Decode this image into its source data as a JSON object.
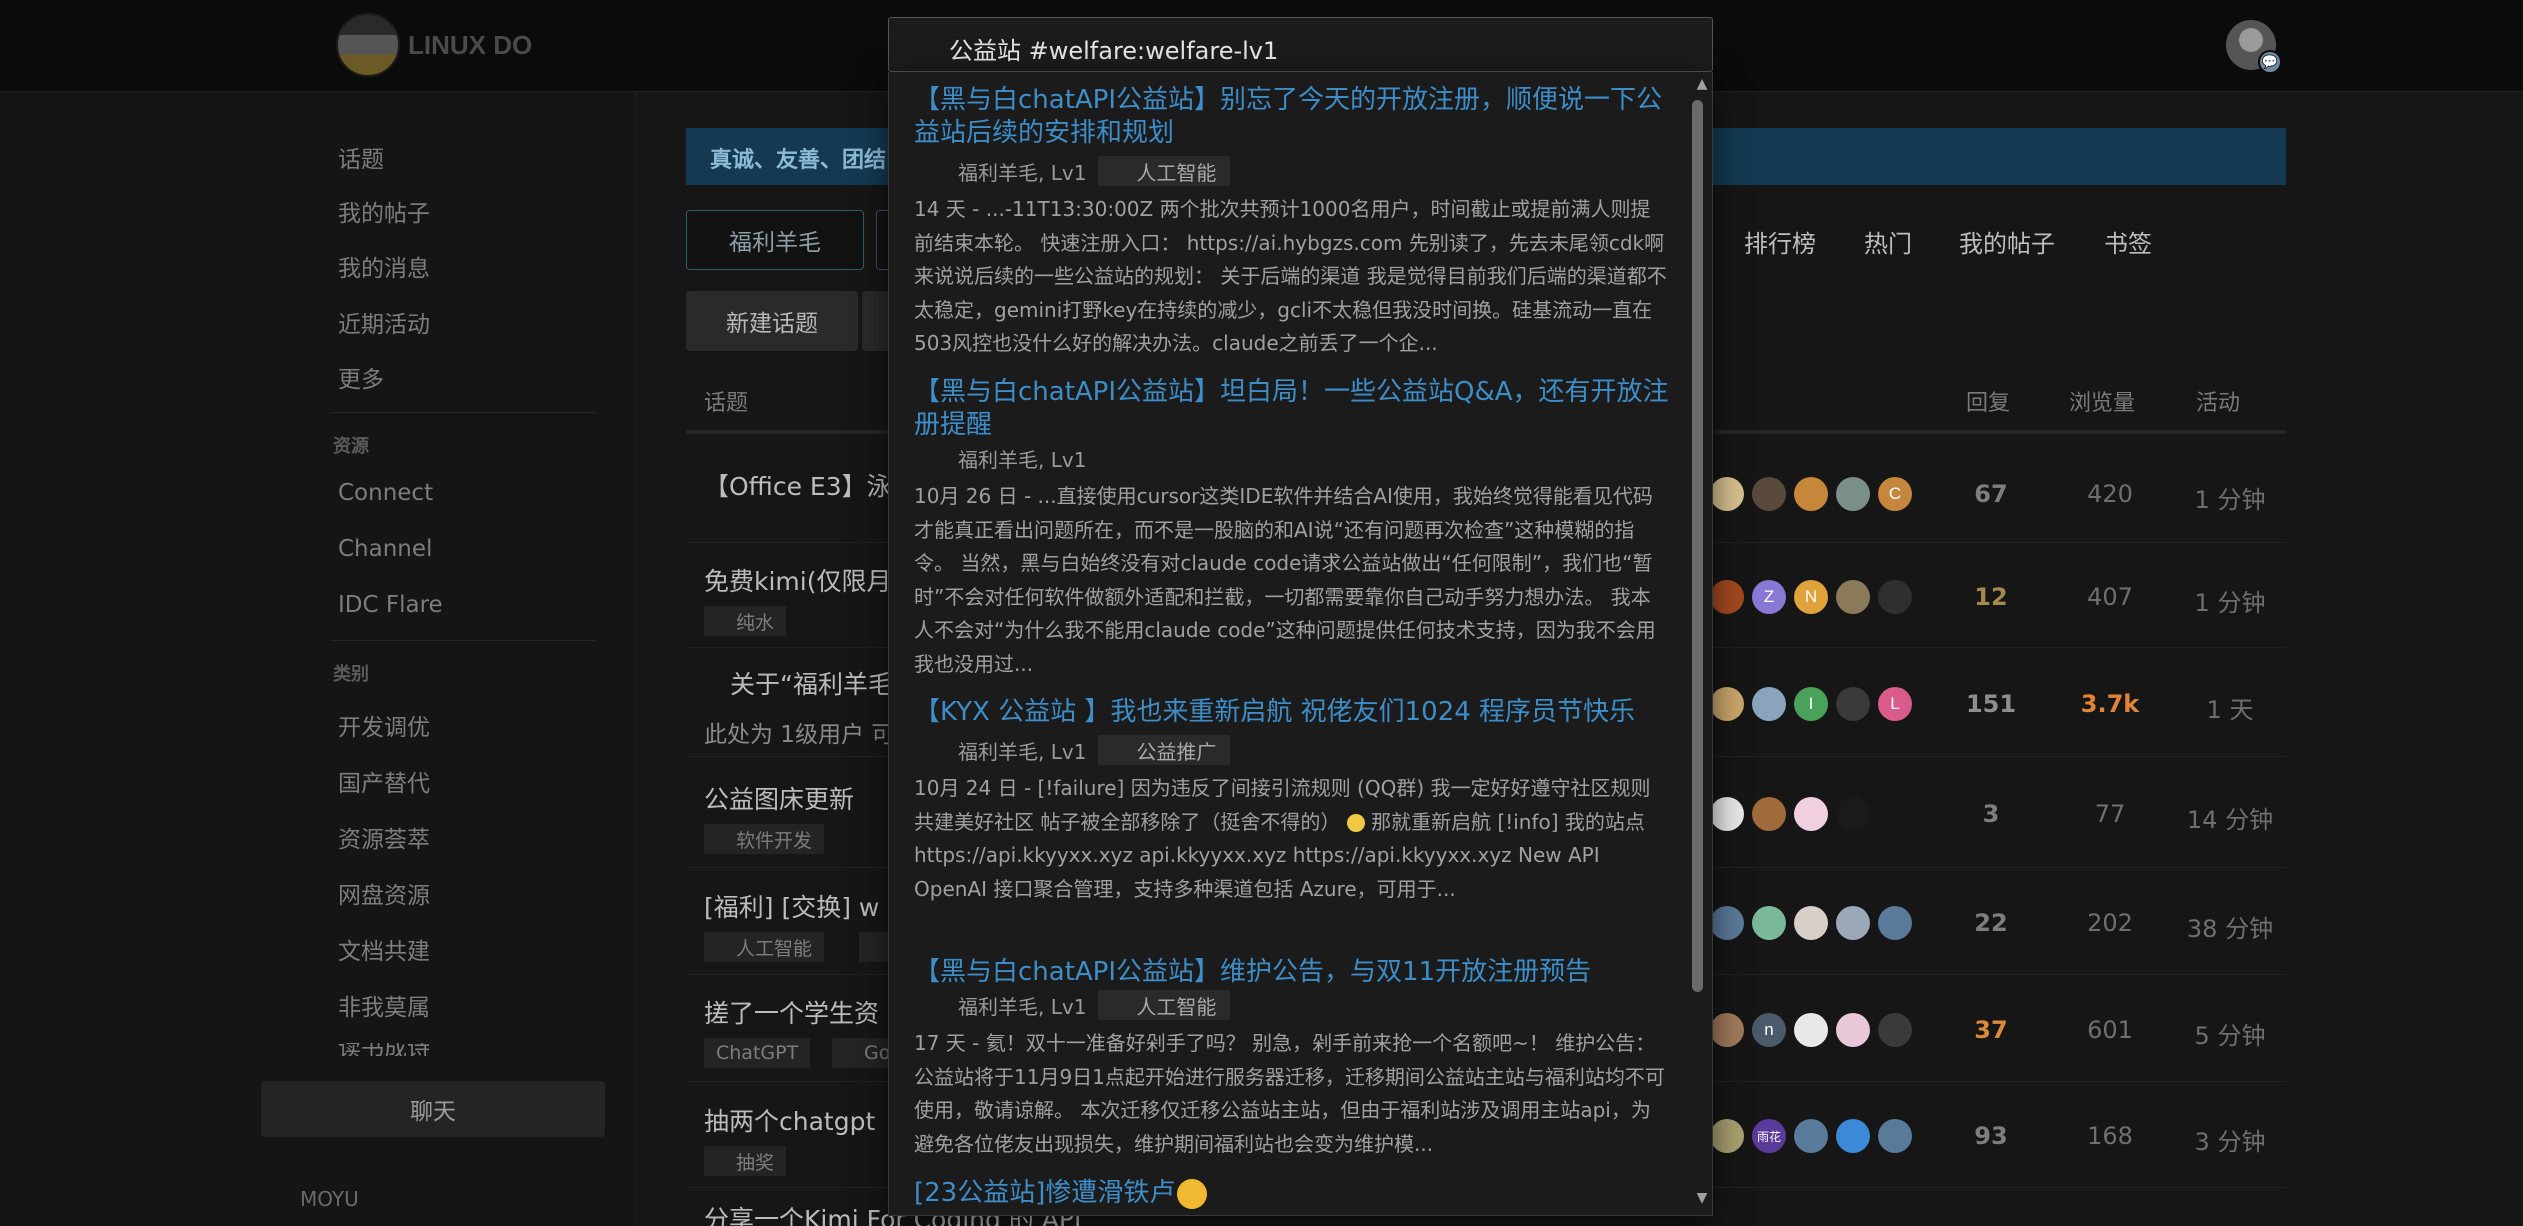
{
  "header": {
    "logo_text": "LINUX DO",
    "chat_badge": "💬"
  },
  "sidebar": {
    "items": [
      "话题",
      "我的帖子",
      "我的消息",
      "近期活动",
      "更多"
    ],
    "resources_label": "资源",
    "resources": [
      "Connect",
      "Channel",
      "IDC Flare"
    ],
    "categories_label": "类别",
    "categories": [
      "开发调优",
      "国产替代",
      "资源荟萃",
      "网盘资源",
      "文档共建",
      "非我莫属",
      "读书成诗"
    ],
    "chat_label": "聊天",
    "moyu_label": "MOYU"
  },
  "main": {
    "banner": "真诚、友善、团结",
    "filter_buttons": [
      "福利羊毛"
    ],
    "nav_links": [
      "排行榜",
      "热门",
      "我的帖子",
      "书签"
    ],
    "new_topic": "新建话题",
    "columns": {
      "topic": "话题",
      "replies": "回复",
      "views": "浏览量",
      "activity": "活动"
    },
    "topics": [
      {
        "title": "【Office E3】泳",
        "tags": [],
        "excerpt": "",
        "avatars": [
          {
            "c": "#d7c08f",
            "t": ""
          },
          {
            "c": "#5a4a3c",
            "t": ""
          },
          {
            "c": "#c7873a",
            "t": ""
          },
          {
            "c": "#7a8f8a",
            "t": ""
          },
          {
            "c": "#c4873d",
            "t": "C"
          }
        ],
        "replies": "67",
        "views": "420",
        "activity": "1 分钟",
        "replies_color": "#7e7e7e",
        "views_color": "#6f6f6f"
      },
      {
        "title": "免费kimi(仅限月",
        "tags": [
          "纯水"
        ],
        "excerpt": "",
        "avatars": [
          {
            "c": "#a34a1e",
            "t": ""
          },
          {
            "c": "#8a78d6",
            "t": "Z"
          },
          {
            "c": "#e0a23a",
            "t": "N"
          },
          {
            "c": "#8a7a5a",
            "t": ""
          },
          {
            "c": "#2f2f2f",
            "t": ""
          }
        ],
        "replies": "12",
        "views": "407",
        "activity": "1 分钟",
        "replies_color": "#a48a4c",
        "views_color": "#6f6f6f"
      },
      {
        "title": "关于“福利羊毛",
        "tags": [],
        "excerpt": "此处为 1级用户 可",
        "avatars": [
          {
            "c": "#c9a76a",
            "t": ""
          },
          {
            "c": "#8aa4bb",
            "t": ""
          },
          {
            "c": "#4aa15a",
            "t": "I"
          },
          {
            "c": "#3a3a3a",
            "t": ""
          },
          {
            "c": "#d95b8c",
            "t": "L"
          }
        ],
        "replies": "151",
        "views": "3.7k",
        "activity": "1 天",
        "replies_color": "#8e8e8e",
        "views_color": "#e1843a"
      },
      {
        "title": "公益图床更新",
        "tags": [
          "软件开发"
        ],
        "excerpt": "",
        "avatars": [
          {
            "c": "#e8e8e8",
            "t": ""
          },
          {
            "c": "#a06a3a",
            "t": ""
          },
          {
            "c": "#f0d0e0",
            "t": ""
          },
          {
            "c": "#1a1a1a",
            "t": ""
          }
        ],
        "replies": "3",
        "views": "77",
        "activity": "14 分钟",
        "replies_color": "#7e7e7e",
        "views_color": "#6f6f6f"
      },
      {
        "title": "[福利] [交换] w",
        "tags": [
          "人工智能",
          "Ch"
        ],
        "excerpt": "",
        "avatars": [
          {
            "c": "#5a7a9a",
            "t": ""
          },
          {
            "c": "#7ab89a",
            "t": ""
          },
          {
            "c": "#d8d0c8",
            "t": ""
          },
          {
            "c": "#9aa8b8",
            "t": ""
          },
          {
            "c": "#5a7a9a",
            "t": ""
          }
        ],
        "replies": "22",
        "views": "202",
        "activity": "38 分钟",
        "replies_color": "#7e7e7e",
        "views_color": "#6f6f6f"
      },
      {
        "title": "搓了一个学生资",
        "tags": [
          "ChatGPT",
          "Goog"
        ],
        "excerpt": "",
        "avatars": [
          {
            "c": "#a07a5a",
            "t": ""
          },
          {
            "c": "#4a5a6a",
            "t": "n"
          },
          {
            "c": "#e8e8e8",
            "t": ""
          },
          {
            "c": "#e8c8d8",
            "t": ""
          },
          {
            "c": "#3a3a3a",
            "t": ""
          }
        ],
        "replies": "37",
        "views": "601",
        "activity": "5 分钟",
        "replies_color": "#d98a3a",
        "views_color": "#6f6f6f"
      },
      {
        "title": "抽两个chatgpt",
        "tags": [
          "抽奖"
        ],
        "excerpt": "",
        "avatars": [
          {
            "c": "#a8a070",
            "t": ""
          },
          {
            "c": "#5a3a9a",
            "t": "雨花"
          },
          {
            "c": "#5a7a9a",
            "t": ""
          },
          {
            "c": "#3a8ad8",
            "t": ""
          },
          {
            "c": "#5a7a9a",
            "t": ""
          }
        ],
        "replies": "93",
        "views": "168",
        "activity": "3 分钟",
        "replies_color": "#7e7e7e",
        "views_color": "#6f6f6f"
      },
      {
        "title": "分享一个Kimi For Coding 的 API",
        "tags": [],
        "excerpt": "",
        "avatars": [],
        "replies": "",
        "views": "",
        "activity": "",
        "replies_color": "#7e7e7e",
        "views_color": "#6f6f6f"
      }
    ]
  },
  "search": {
    "query": "公益站 #welfare:welfare-lv1",
    "results": [
      {
        "title": "【黑与白chatAPI公益站】别忘了今天的开放注册，顺便说一下公益站后续的安排和规划",
        "author": "福利羊毛, Lv1",
        "category": "人工智能",
        "blurb": "14 天 - ...-11T13:30:00Z 两个批次共预计1000名用户，时间截止或提前满人则提前结束本轮。 快速注册入口： https://ai.hybgzs.com 先别读了，先去未尾领cdk啊 来说说后续的一些公益站的规划： 关于后端的渠道 我是觉得目前我们后端的渠道都不太稳定，gemini打野key在持续的减少，gcli不太稳但我没时间换。硅基流动一直在503风控也没什么好的解决办法。claude之前丢了一个企..."
      },
      {
        "title": "【黑与白chatAPI公益站】坦白局！一些公益站Q&A，还有开放注册提醒",
        "author": "福利羊毛, Lv1",
        "category": "",
        "blurb": "10月 26 日 - ...直接使用cursor这类IDE软件并结合AI使用，我始终觉得能看见代码才能真正看出问题所在，而不是一股脑的和AI说“还有问题再次检查”这种模糊的指令。 当然，黑与白始终没有对claude code请求公益站做出“任何限制”，我们也“暂时”不会对任何软件做额外适配和拦截，一切都需要靠你自己动手努力想办法。 我本人不会对“为什么我不能用claude code”这种问题提供任何技术支持，因为我不会用我也没用过..."
      },
      {
        "title": "【KYX 公益站 】我也来重新启航 祝佬友们1024 程序员节快乐",
        "author": "福利羊毛, Lv1",
        "category": "公益推广",
        "blurb_before": "10月 24 日 - [!failure] 因为违反了间接引流规则 (QQ群) 我一定好好遵守社区规则共建美好社区 帖子被全部移除了（挺舍不得的）",
        "blurb_after": "那就重新启航 [!info] 我的站点 https://api.kkyyxx.xyz api.kkyyxx.xyz https://api.kkyyxx.xyz New API OpenAI 接口聚合管理，支持多种渠道包括 Azure，可用于..."
      },
      {
        "title": "【黑与白chatAPI公益站】维护公告，与双11开放注册预告",
        "author": "福利羊毛, Lv1",
        "category": "人工智能",
        "blurb": "17 天 - 氦！双十一准备好剁手了吗？ 别急，剁手前来抢一个名额吧~！ 维护公告： 公益站将于11月9日1点起开始进行服务器迁移，迁移期间公益站主站与福利站均不可使用，敬请谅解。 本次迁移仅迁移公益站主站，但由于福利站涉及调用主站api，为避免各位佬友出现损失，维护期间福利站也会变为维护模..."
      },
      {
        "title": "[23公益站]惨遭滑铁卢",
        "author": "",
        "category": "",
        "blurb": ""
      }
    ]
  }
}
